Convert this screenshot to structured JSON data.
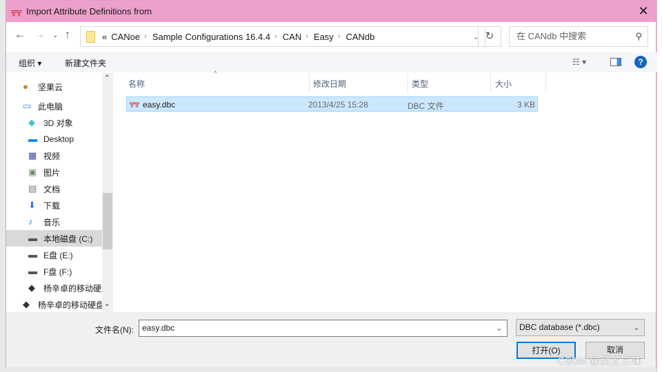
{
  "title": "Import Attribute Definitions from",
  "address": {
    "crumbs": [
      "CANoe",
      "Sample Configurations 16.4.4",
      "CAN",
      "Easy",
      "CANdb"
    ],
    "overflow": "«"
  },
  "search": {
    "placeholder": "在 CANdb 中搜索"
  },
  "toolbar": {
    "organize": "组织 ▾",
    "new_folder": "新建文件夹"
  },
  "sidebar": {
    "items": [
      {
        "label": "坚果云",
        "icon": "nut-icon"
      },
      {
        "label": "此电脑",
        "icon": "computer-icon"
      },
      {
        "label": "3D 对象",
        "icon": "cube-icon"
      },
      {
        "label": "Desktop",
        "icon": "desktop-icon"
      },
      {
        "label": "视频",
        "icon": "video-icon"
      },
      {
        "label": "图片",
        "icon": "picture-icon"
      },
      {
        "label": "文档",
        "icon": "document-icon"
      },
      {
        "label": "下载",
        "icon": "download-icon"
      },
      {
        "label": "音乐",
        "icon": "music-icon"
      },
      {
        "label": "本地磁盘 (C:)",
        "icon": "drive-icon",
        "selected": true
      },
      {
        "label": "E盘 (E:)",
        "icon": "drive-icon"
      },
      {
        "label": "F盘 (F:)",
        "icon": "drive-icon"
      },
      {
        "label": "杨辛卓的移动硬盘",
        "icon": "usb-drive-icon"
      },
      {
        "label": "杨辛卓的移动硬盘",
        "icon": "usb-drive-icon"
      }
    ]
  },
  "columns": [
    "名称",
    "修改日期",
    "类型",
    "大小"
  ],
  "files": [
    {
      "name": "easy.dbc",
      "modified": "2013/4/25 15:28",
      "type": "DBC 文件",
      "size": "3 KB"
    }
  ],
  "footer": {
    "filename_label": "文件名(N):",
    "filename_value": "easy.dbc",
    "filter": "DBC database (*.dbc)",
    "open": "打开(O)",
    "cancel": "取消"
  },
  "watermark": "CSDN @灵芝三味"
}
